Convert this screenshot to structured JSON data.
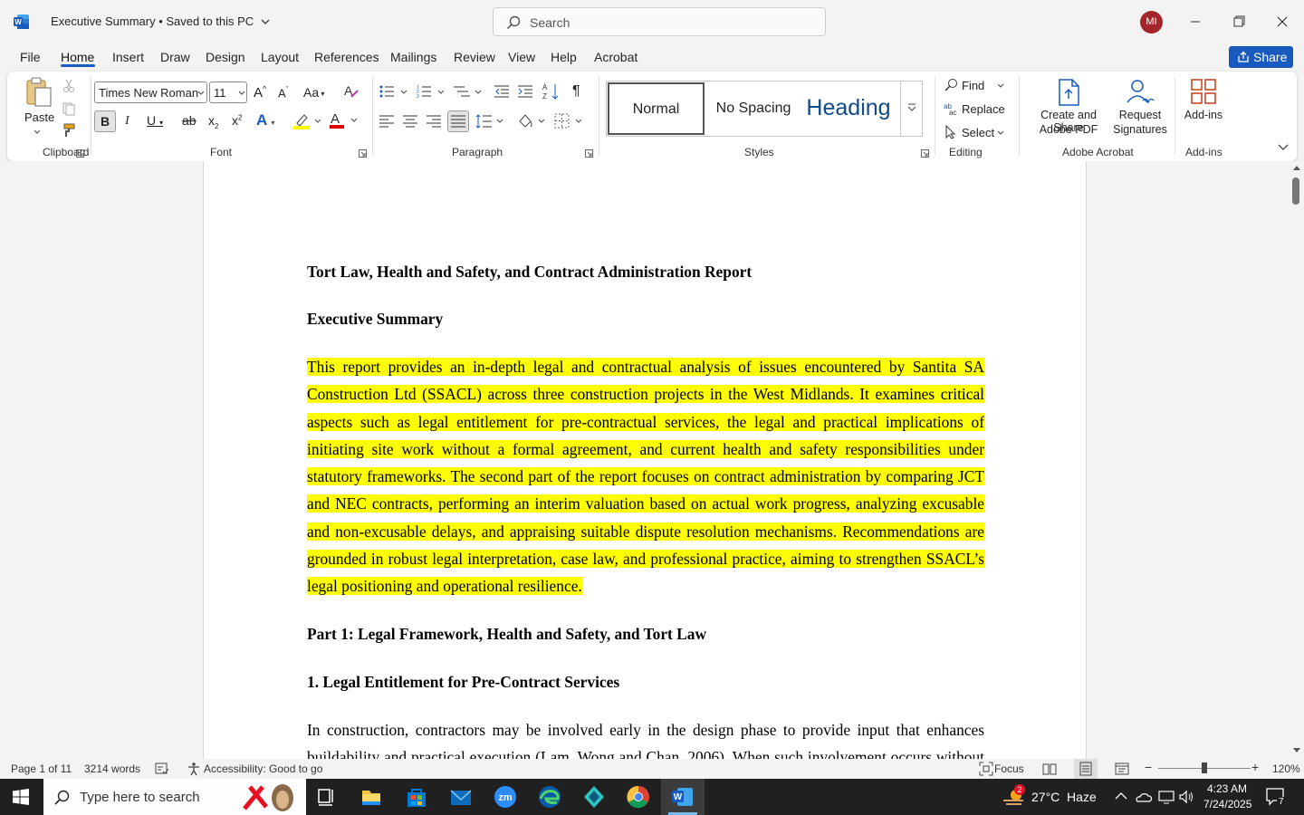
{
  "titlebar": {
    "app_icon": "word-logo-icon",
    "doc_title": "Executive Summary • Saved to this PC",
    "search_placeholder": "Search",
    "avatar_initials": "MI"
  },
  "menu": {
    "tabs": [
      "File",
      "Home",
      "Insert",
      "Draw",
      "Design",
      "Layout",
      "References",
      "Mailings",
      "Review",
      "View",
      "Help",
      "Acrobat"
    ],
    "active": "Home",
    "share_label": "Share"
  },
  "ribbon": {
    "clipboard": {
      "paste_label": "Paste",
      "group_label": "Clipboard"
    },
    "font": {
      "font_name": "Times New Roman",
      "font_size": "11",
      "group_label": "Font"
    },
    "paragraph": {
      "group_label": "Paragraph"
    },
    "styles": {
      "items": [
        "Normal",
        "No Spacing",
        "Heading"
      ],
      "group_label": "Styles"
    },
    "editing": {
      "find": "Find",
      "replace": "Replace",
      "select": "Select",
      "group_label": "Editing"
    },
    "acrobat": {
      "create_line1": "Create and Share",
      "create_line2": "Adobe PDF",
      "request_line1": "Request",
      "request_line2": "Signatures",
      "group_label": "Adobe Acrobat"
    },
    "addins": {
      "label": "Add-ins",
      "group_label": "Add-ins"
    }
  },
  "document": {
    "title": "Tort Law, Health and Safety, and Contract Administration Report",
    "exec_heading": "Executive Summary",
    "exec_paragraph": "This report provides an in-depth legal and contractual analysis of issues encountered by Santita SA Construction Ltd (SSACL) across three construction projects in the West Midlands. It examines critical aspects such as legal entitlement for pre-contractual services, the legal and practical implications of initiating site work without a formal agreement, and current health and safety responsibilities under statutory frameworks. The second part of the report focuses on contract administration by comparing JCT and NEC contracts, performing an interim valuation based on actual work progress, analyzing excusable and non-excusable delays, and appraising suitable dispute resolution mechanisms. Recommendations are grounded in robust legal interpretation, case law, and professional practice, aiming to strengthen SSACL’s legal positioning and operational resilience.",
    "part1_heading": "Part 1: Legal Framework, Health and Safety, and Tort Law",
    "section1_heading": "1. Legal Entitlement for Pre-Contract Services",
    "section1_paragraph": "In construction, contractors may be involved early in the design phase to provide input that enhances buildability and practical execution (Lam, Wong and Chan, 2006). When such involvement occurs without"
  },
  "statusbar": {
    "page": "Page 1 of 11",
    "words": "3214 words",
    "accessibility": "Accessibility: Good to go",
    "focus": "Focus",
    "zoom": "120%"
  },
  "taskbar": {
    "search_placeholder": "Type here to search",
    "weather": "27°C  Haze",
    "weather_badge": "2",
    "time": "4:23 AM",
    "date": "7/24/2025",
    "notifications": "7"
  },
  "colors": {
    "accent": "#185abd",
    "highlight": "#ffff00",
    "avatar": "#a4262c"
  }
}
